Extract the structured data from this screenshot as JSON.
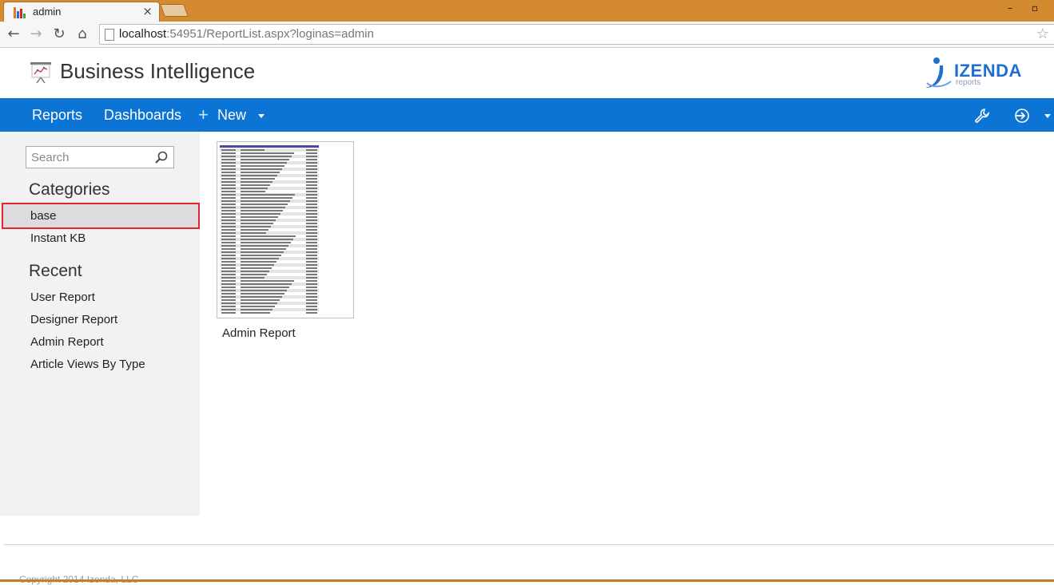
{
  "browser": {
    "tab_title": "admin",
    "tab_close": "×",
    "window_controls": "–  ▫",
    "url_host": "localhost",
    "url_rest": ":54951/ReportList.aspx?loginas=admin",
    "nav_icons": [
      "back-arrow-icon",
      "forward-arrow-icon",
      "reload-icon",
      "home-icon"
    ]
  },
  "header": {
    "title": "Business Intelligence",
    "brand_word": "IZENDA",
    "brand_sub": "reports"
  },
  "navbar": {
    "reports": "Reports",
    "dashboards": "Dashboards",
    "new_plus": "+",
    "new": "New",
    "icons": [
      "wrench-icon",
      "sign-in-icon"
    ]
  },
  "sidebar": {
    "search_placeholder": "Search",
    "categories_title": "Categories",
    "categories": [
      "base",
      "Instant KB"
    ],
    "selected_category": "base",
    "recent_title": "Recent",
    "recent": [
      "User Report",
      "Designer Report",
      "Admin Report",
      "Article Views By Type"
    ]
  },
  "main": {
    "reports": [
      {
        "name": "Admin Report"
      }
    ]
  },
  "footer": {
    "copyright": "Copyright 2014 Izenda, LLC"
  },
  "colors": {
    "navbar": "#0c74d4",
    "tabstrip": "#d48a2e",
    "selection_border": "#e0262c",
    "brand": "#1f6fd1"
  }
}
